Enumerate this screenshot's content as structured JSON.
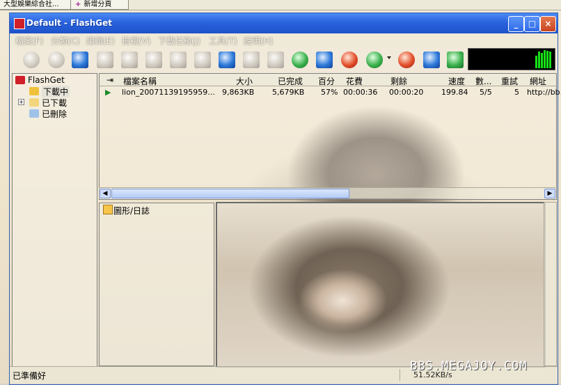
{
  "taskbar": {
    "button_1": "大型娛樂綜合社...",
    "button_2": "新增分頁"
  },
  "window": {
    "title": "Default - FlashGet",
    "controls": {
      "minimize": "_",
      "maximize": "□",
      "close": "×"
    }
  },
  "menu": [
    "檔案(F)",
    "分類(C)",
    "編輯(E)",
    "檢視(V)",
    "下載任務(J)",
    "工具(T)",
    "說明(H)"
  ],
  "toolbar": {
    "icons": [
      "play-icon",
      "pause-icon",
      "new-task-icon",
      "delete-icon",
      "properties-icon",
      "move-up-icon",
      "move-down-icon",
      "folder-icon",
      "find-icon",
      "binoculars-icon",
      "globe-icon",
      "settings-icon",
      "gear-icon",
      "connect-icon",
      "disconnect-icon",
      "schedule-icon",
      "monitor-icon"
    ]
  },
  "tree": {
    "root": "FlashGet",
    "items": [
      "下載中",
      "已下載",
      "已刪除"
    ],
    "selected": "下載中"
  },
  "list": {
    "headers": [
      "檔案名稱",
      "大小",
      "已完成",
      "百分",
      "花費",
      "剩餘",
      "速度",
      "數...",
      "重試",
      "網址"
    ],
    "rows": [
      {
        "name": "lion_20071139195959...",
        "size": "9,863KB",
        "done": "5,679KB",
        "percent": "57%",
        "elapsed": "00:00:36",
        "remaining": "00:00:20",
        "speed": "199.84",
        "count": "5/5",
        "retry": "5",
        "url": "http://bb..."
      }
    ]
  },
  "log_pane": {
    "title": "圖形/日誌"
  },
  "status": {
    "left": "已準備好",
    "right": "51.52KB/s"
  },
  "watermark": "BBS.MEGAJOY.COM",
  "colors": {
    "titlebar": "#2a63de",
    "graph_bg": "#000000",
    "graph_bar": "#17e017"
  }
}
